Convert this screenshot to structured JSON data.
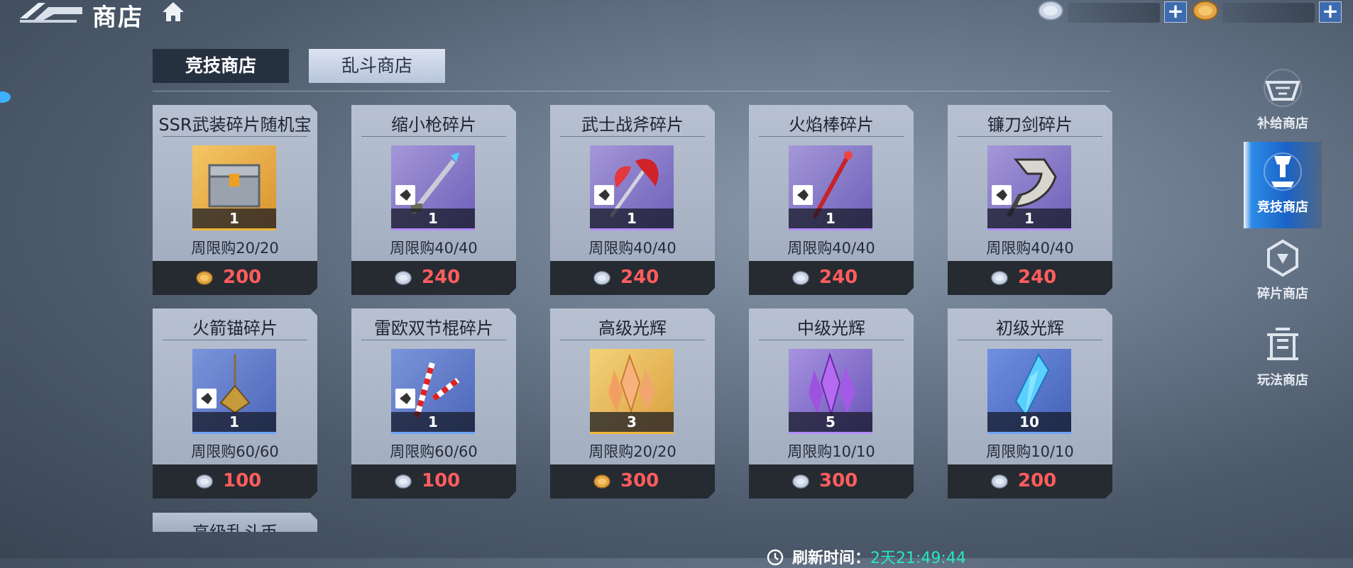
{
  "header": {
    "title": "商店",
    "currencies": [
      {
        "icon": "silver-coin-icon",
        "amount": "",
        "add_label": "+"
      },
      {
        "icon": "gold-coin-icon",
        "amount": "",
        "add_label": "+"
      }
    ]
  },
  "tabs": [
    {
      "label": "竞技商店",
      "selected": true
    },
    {
      "label": "乱斗商店",
      "selected": false
    }
  ],
  "items": [
    {
      "name": "SSR武装碎片随机宝",
      "qty": "1",
      "limit": "周限购20/20",
      "currency": "gold-coin-icon",
      "price": "200",
      "image": "treasure-chest-icon"
    },
    {
      "name": "缩小枪碎片",
      "qty": "1",
      "limit": "周限购40/40",
      "currency": "silver-coin-icon",
      "price": "240",
      "image": "shrink-gun-icon"
    },
    {
      "name": "武士战斧碎片",
      "qty": "1",
      "limit": "周限购40/40",
      "currency": "silver-coin-icon",
      "price": "240",
      "image": "battle-axe-icon"
    },
    {
      "name": "火焰棒碎片",
      "qty": "1",
      "limit": "周限购40/40",
      "currency": "silver-coin-icon",
      "price": "240",
      "image": "flame-rod-icon"
    },
    {
      "name": "镰刀剑碎片",
      "qty": "1",
      "limit": "周限购40/40",
      "currency": "silver-coin-icon",
      "price": "240",
      "image": "scythe-sword-icon"
    },
    {
      "name": "火箭锚碎片",
      "qty": "1",
      "limit": "周限购60/60",
      "currency": "silver-coin-icon",
      "price": "100",
      "image": "rocket-anchor-icon"
    },
    {
      "name": "雷欧双节棍碎片",
      "qty": "1",
      "limit": "周限购60/60",
      "currency": "silver-coin-icon",
      "price": "100",
      "image": "nunchaku-icon"
    },
    {
      "name": "高级光辉",
      "qty": "3",
      "limit": "周限购20/20",
      "currency": "gold-coin-icon",
      "price": "300",
      "image": "orange-crystal-icon"
    },
    {
      "name": "中级光辉",
      "qty": "5",
      "limit": "周限购10/10",
      "currency": "silver-coin-icon",
      "price": "300",
      "image": "purple-crystal-icon"
    },
    {
      "name": "初级光辉",
      "qty": "10",
      "limit": "周限购10/10",
      "currency": "silver-coin-icon",
      "price": "200",
      "image": "blue-crystal-icon"
    }
  ],
  "partial_item": {
    "name": "高级乱斗币"
  },
  "refresh": {
    "label": "刷新时间：",
    "time": "2天21:49:44"
  },
  "side_nav": [
    {
      "label": "补给商店",
      "icon": "supply-shop-icon",
      "selected": false
    },
    {
      "label": "竞技商店",
      "icon": "arena-shop-icon",
      "selected": true
    },
    {
      "label": "碎片商店",
      "icon": "fragment-shop-icon",
      "selected": false
    },
    {
      "label": "玩法商店",
      "icon": "gameplay-shop-icon",
      "selected": false
    }
  ],
  "colors": {
    "price": "#ff5d5d",
    "refresh_time": "#28e6c4",
    "tab_selected_bg": "#263140",
    "card_bg": "#b0bbcc"
  }
}
